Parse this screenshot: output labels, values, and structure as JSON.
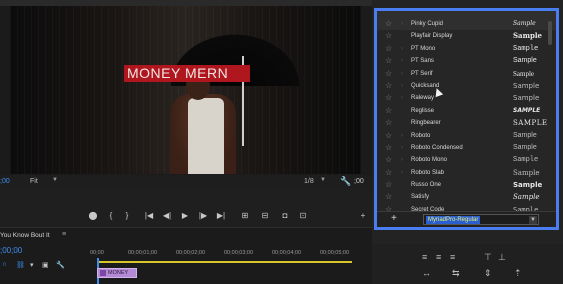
{
  "program_monitor": {
    "title_text": "MONEY MERN",
    "timecode_left": ";00",
    "zoom_select": "Fit",
    "resolution": "1/8",
    "timecode_right": ";00"
  },
  "timeline": {
    "sequence_name": "You Know Bout It",
    "menu_glyph": "≡",
    "timecode": ";00;00",
    "ruler_ticks": [
      "00;00",
      "00;00;01;00",
      "00;00;02;00",
      "00;00;03;00",
      "00;00;04;00",
      "00;00;05;00"
    ],
    "clip_label": "MONEY"
  },
  "font_picker": {
    "fonts": [
      {
        "name": "Pinky Cupid",
        "sample": "Sample"
      },
      {
        "name": "Playfair Display",
        "sample": "Sample"
      },
      {
        "name": "PT Mono",
        "sample": "Sample"
      },
      {
        "name": "PT Sans",
        "sample": "Sample"
      },
      {
        "name": "PT Serif",
        "sample": "Sample"
      },
      {
        "name": "Quicksand",
        "sample": "Sample"
      },
      {
        "name": "Raleway",
        "sample": "Sample"
      },
      {
        "name": "Reglisse",
        "sample": "SAMPLE"
      },
      {
        "name": "Ringbearer",
        "sample": "SAMPLE"
      },
      {
        "name": "Roboto",
        "sample": "Sample"
      },
      {
        "name": "Roboto Condensed",
        "sample": "Sample"
      },
      {
        "name": "Roboto Mono",
        "sample": "Sample"
      },
      {
        "name": "Roboto Slab",
        "sample": "Sample"
      },
      {
        "name": "Russo One",
        "sample": "Sample"
      },
      {
        "name": "Satisfy",
        "sample": "Sample"
      },
      {
        "name": "Secret Code",
        "sample": "Sample"
      }
    ],
    "selected_font": "MyriadPro-Regular",
    "add_label": "+",
    "accent_color": "#4a7df0"
  }
}
